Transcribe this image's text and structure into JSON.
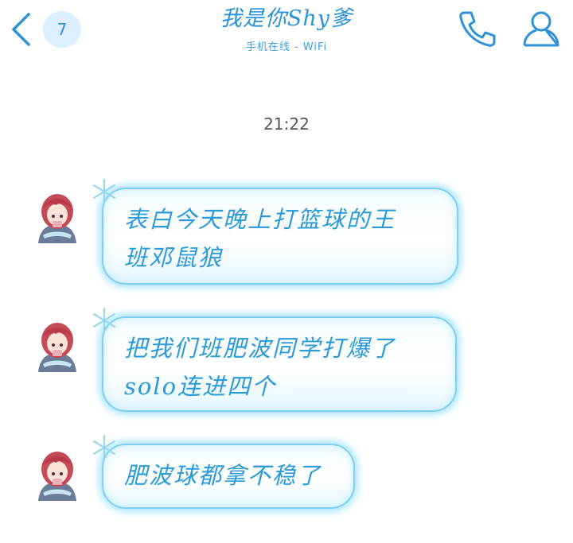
{
  "header": {
    "back_icon": "chevron-left-icon",
    "unread_count": "7",
    "title": "我是你Shy爹",
    "status": "手机在线 - WiFi",
    "call_icon": "phone-icon",
    "profile_icon": "person-icon",
    "accent": "#2a93d9"
  },
  "chat": {
    "timestamp": "21:22",
    "messages": [
      {
        "text": "表白今天晚上打篮球的王班邓鼠狼",
        "lines": [
          "表白今天晚上打篮球的王",
          "班邓鼠狼"
        ]
      },
      {
        "text": "把我们班肥波同学打爆了solo连进四个",
        "lines": [
          "把我们班肥波同学打爆了",
          "solo连进四个"
        ]
      },
      {
        "text": "肥波球都拿不稳了",
        "lines": [
          "肥波球都拿不稳了"
        ]
      }
    ]
  }
}
